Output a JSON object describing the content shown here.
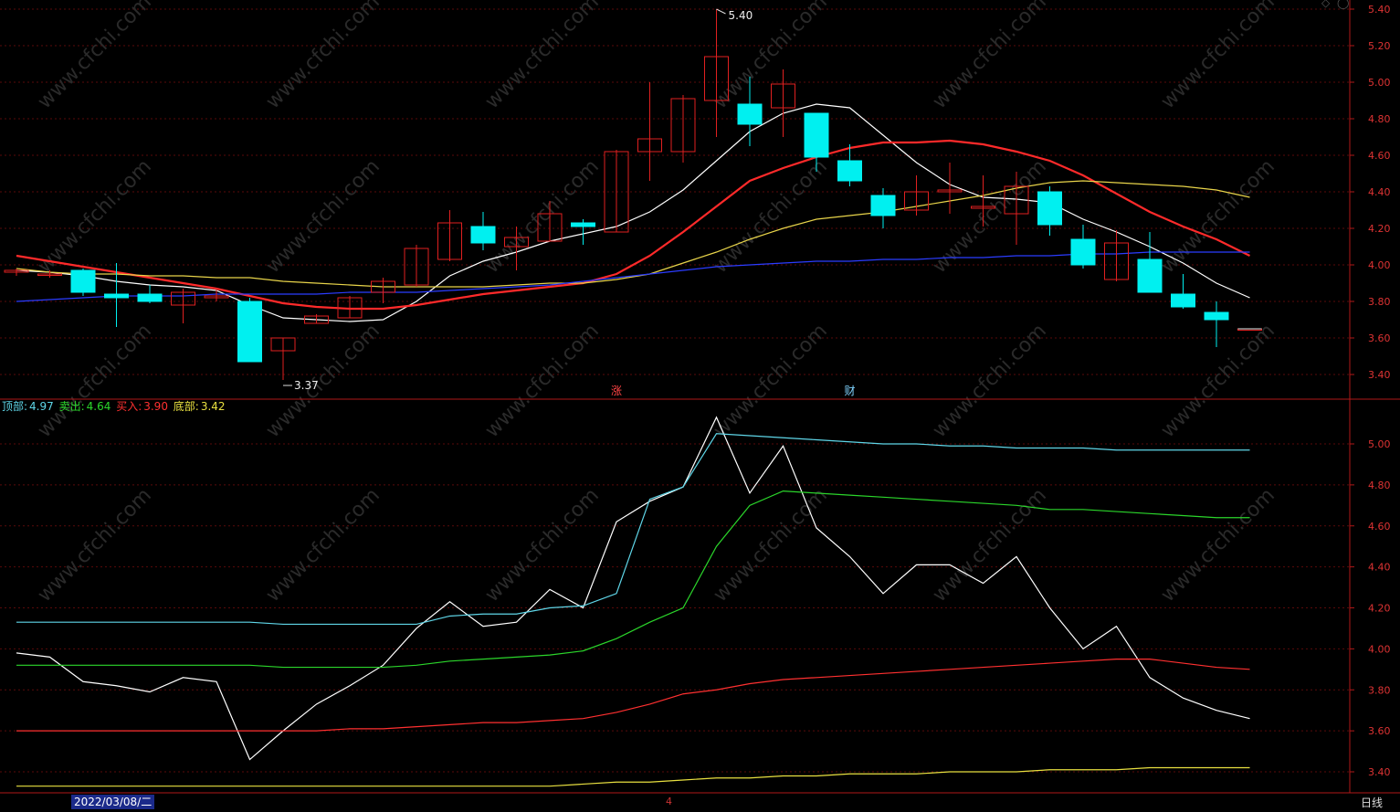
{
  "chart_data": [
    {
      "type": "candlestick",
      "y_axis_ticks": [
        "5.40",
        "5.20",
        "5.00",
        "4.80",
        "4.60",
        "4.40",
        "4.20",
        "4.00",
        "3.80",
        "3.60",
        "3.40"
      ],
      "ylim": [
        3.3,
        5.45
      ],
      "high_label": "5.40",
      "low_label": "3.37",
      "event_markers": [
        {
          "text": "涨",
          "index": 18,
          "color": "#ff4444"
        },
        {
          "text": "财",
          "index": 25,
          "color": "#7fd3ff"
        }
      ],
      "candles": [
        {
          "o": 3.96,
          "h": 3.98,
          "l": 3.94,
          "c": 3.97
        },
        {
          "o": 3.95,
          "h": 3.97,
          "l": 3.93,
          "c": 3.95
        },
        {
          "o": 3.97,
          "h": 3.98,
          "l": 3.83,
          "c": 3.85
        },
        {
          "o": 3.84,
          "h": 4.01,
          "l": 3.66,
          "c": 3.82
        },
        {
          "o": 3.84,
          "h": 3.89,
          "l": 3.79,
          "c": 3.8
        },
        {
          "o": 3.78,
          "h": 3.87,
          "l": 3.68,
          "c": 3.85
        },
        {
          "o": 3.82,
          "h": 3.87,
          "l": 3.8,
          "c": 3.83
        },
        {
          "o": 3.8,
          "h": 3.82,
          "l": 3.47,
          "c": 3.47
        },
        {
          "o": 3.53,
          "h": 3.6,
          "l": 3.37,
          "c": 3.6
        },
        {
          "o": 3.68,
          "h": 3.73,
          "l": 3.68,
          "c": 3.72
        },
        {
          "o": 3.71,
          "h": 3.83,
          "l": 3.71,
          "c": 3.82
        },
        {
          "o": 3.85,
          "h": 3.93,
          "l": 3.79,
          "c": 3.91
        },
        {
          "o": 3.89,
          "h": 4.11,
          "l": 3.88,
          "c": 4.09
        },
        {
          "o": 4.03,
          "h": 4.3,
          "l": 4.02,
          "c": 4.23
        },
        {
          "o": 4.21,
          "h": 4.29,
          "l": 4.08,
          "c": 4.12
        },
        {
          "o": 4.1,
          "h": 4.21,
          "l": 3.97,
          "c": 4.15
        },
        {
          "o": 4.13,
          "h": 4.35,
          "l": 4.13,
          "c": 4.28
        },
        {
          "o": 4.23,
          "h": 4.25,
          "l": 4.11,
          "c": 4.21
        },
        {
          "o": 4.18,
          "h": 4.63,
          "l": 4.18,
          "c": 4.62
        },
        {
          "o": 4.62,
          "h": 5.0,
          "l": 4.46,
          "c": 4.69
        },
        {
          "o": 4.62,
          "h": 4.93,
          "l": 4.56,
          "c": 4.91
        },
        {
          "o": 4.9,
          "h": 5.4,
          "l": 4.7,
          "c": 5.14
        },
        {
          "o": 4.88,
          "h": 5.03,
          "l": 4.65,
          "c": 4.77
        },
        {
          "o": 4.86,
          "h": 5.07,
          "l": 4.7,
          "c": 4.99
        },
        {
          "o": 4.83,
          "h": 4.83,
          "l": 4.51,
          "c": 4.59
        },
        {
          "o": 4.57,
          "h": 4.66,
          "l": 4.43,
          "c": 4.46
        },
        {
          "o": 4.38,
          "h": 4.42,
          "l": 4.2,
          "c": 4.27
        },
        {
          "o": 4.3,
          "h": 4.49,
          "l": 4.27,
          "c": 4.4
        },
        {
          "o": 4.4,
          "h": 4.56,
          "l": 4.28,
          "c": 4.41
        },
        {
          "o": 4.31,
          "h": 4.49,
          "l": 4.21,
          "c": 4.32
        },
        {
          "o": 4.28,
          "h": 4.51,
          "l": 4.11,
          "c": 4.43
        },
        {
          "o": 4.4,
          "h": 4.43,
          "l": 4.16,
          "c": 4.22
        },
        {
          "o": 4.14,
          "h": 4.22,
          "l": 3.98,
          "c": 4.0
        },
        {
          "o": 3.92,
          "h": 4.19,
          "l": 3.91,
          "c": 4.12
        },
        {
          "o": 4.03,
          "h": 4.18,
          "l": 3.85,
          "c": 3.85
        },
        {
          "o": 3.84,
          "h": 3.95,
          "l": 3.76,
          "c": 3.77
        },
        {
          "o": 3.74,
          "h": 3.8,
          "l": 3.55,
          "c": 3.7
        },
        {
          "o": 3.65,
          "h": 3.65,
          "l": 3.65,
          "c": 3.65
        }
      ],
      "series": [
        {
          "color": "#ffffff",
          "values": [
            3.97,
            3.96,
            3.94,
            3.91,
            3.89,
            3.88,
            3.86,
            3.78,
            3.71,
            3.7,
            3.69,
            3.7,
            3.8,
            3.94,
            4.02,
            4.07,
            4.13,
            4.17,
            4.21,
            4.29,
            4.41,
            4.57,
            4.73,
            4.83,
            4.88,
            4.86,
            4.71,
            4.56,
            4.44,
            4.37,
            4.36,
            4.34,
            4.25,
            4.18,
            4.1,
            4.01,
            3.9,
            3.82
          ]
        },
        {
          "color": "#ff2a2a",
          "values": [
            4.05,
            4.02,
            3.99,
            3.96,
            3.93,
            3.9,
            3.87,
            3.83,
            3.79,
            3.77,
            3.76,
            3.76,
            3.78,
            3.81,
            3.84,
            3.86,
            3.88,
            3.9,
            3.95,
            4.05,
            4.18,
            4.32,
            4.46,
            4.53,
            4.59,
            4.64,
            4.67,
            4.67,
            4.68,
            4.66,
            4.62,
            4.57,
            4.49,
            4.39,
            4.29,
            4.21,
            4.14,
            4.05
          ]
        },
        {
          "color": "#e8d44a",
          "values": [
            3.98,
            3.96,
            3.95,
            3.95,
            3.94,
            3.94,
            3.93,
            3.93,
            3.91,
            3.9,
            3.89,
            3.88,
            3.88,
            3.88,
            3.88,
            3.89,
            3.9,
            3.9,
            3.92,
            3.95,
            4.01,
            4.07,
            4.14,
            4.2,
            4.25,
            4.27,
            4.29,
            4.32,
            4.35,
            4.38,
            4.42,
            4.45,
            4.46,
            4.45,
            4.44,
            4.43,
            4.41,
            4.37
          ]
        },
        {
          "color": "#2b3cff",
          "values": [
            3.8,
            3.81,
            3.82,
            3.83,
            3.83,
            3.83,
            3.84,
            3.84,
            3.84,
            3.84,
            3.85,
            3.85,
            3.85,
            3.86,
            3.87,
            3.88,
            3.89,
            3.91,
            3.93,
            3.95,
            3.97,
            3.99,
            4.0,
            4.01,
            4.02,
            4.02,
            4.03,
            4.03,
            4.04,
            4.04,
            4.05,
            4.05,
            4.06,
            4.06,
            4.07,
            4.07,
            4.07,
            4.07
          ]
        }
      ]
    },
    {
      "type": "line",
      "y_axis_ticks": [
        "5.00",
        "4.80",
        "4.60",
        "4.40",
        "4.20",
        "4.00",
        "3.80",
        "3.60",
        "3.40"
      ],
      "ylim": [
        3.3,
        5.2
      ],
      "legend": [
        {
          "label": "顶部:",
          "value": "4.97",
          "color": "#5fd6e8"
        },
        {
          "label": "卖出:",
          "value": "4.64",
          "color": "#2bd62b"
        },
        {
          "label": "买入:",
          "value": "3.90",
          "color": "#ff3030"
        },
        {
          "label": "底部:",
          "value": "3.42",
          "color": "#e8e040"
        }
      ],
      "series": [
        {
          "color": "#ffffff",
          "values": [
            3.98,
            3.96,
            3.84,
            3.82,
            3.79,
            3.86,
            3.84,
            3.46,
            3.6,
            3.73,
            3.82,
            3.92,
            4.1,
            4.23,
            4.11,
            4.13,
            4.29,
            4.2,
            4.62,
            4.72,
            4.79,
            5.13,
            4.76,
            4.99,
            4.59,
            4.45,
            4.27,
            4.41,
            4.41,
            4.32,
            4.45,
            4.2,
            4.0,
            4.11,
            3.86,
            3.76,
            3.7,
            3.66
          ]
        },
        {
          "color": "#5fd6e8",
          "values": [
            4.13,
            4.13,
            4.13,
            4.13,
            4.13,
            4.13,
            4.13,
            4.13,
            4.12,
            4.12,
            4.12,
            4.12,
            4.12,
            4.16,
            4.17,
            4.17,
            4.2,
            4.21,
            4.27,
            4.73,
            4.79,
            5.05,
            5.04,
            5.03,
            5.02,
            5.01,
            5.0,
            5.0,
            4.99,
            4.99,
            4.98,
            4.98,
            4.98,
            4.97,
            4.97,
            4.97,
            4.97,
            4.97
          ]
        },
        {
          "color": "#2bd62b",
          "values": [
            3.92,
            3.92,
            3.92,
            3.92,
            3.92,
            3.92,
            3.92,
            3.92,
            3.91,
            3.91,
            3.91,
            3.91,
            3.92,
            3.94,
            3.95,
            3.96,
            3.97,
            3.99,
            4.05,
            4.13,
            4.2,
            4.5,
            4.7,
            4.77,
            4.76,
            4.75,
            4.74,
            4.73,
            4.72,
            4.71,
            4.7,
            4.68,
            4.68,
            4.67,
            4.66,
            4.65,
            4.64,
            4.64
          ]
        },
        {
          "color": "#ff3030",
          "values": [
            3.6,
            3.6,
            3.6,
            3.6,
            3.6,
            3.6,
            3.6,
            3.6,
            3.6,
            3.6,
            3.61,
            3.61,
            3.62,
            3.63,
            3.64,
            3.64,
            3.65,
            3.66,
            3.69,
            3.73,
            3.78,
            3.8,
            3.83,
            3.85,
            3.86,
            3.87,
            3.88,
            3.89,
            3.9,
            3.91,
            3.92,
            3.93,
            3.94,
            3.95,
            3.95,
            3.93,
            3.91,
            3.9
          ]
        },
        {
          "color": "#e8e040",
          "values": [
            3.33,
            3.33,
            3.33,
            3.33,
            3.33,
            3.33,
            3.33,
            3.33,
            3.33,
            3.33,
            3.33,
            3.33,
            3.33,
            3.33,
            3.33,
            3.33,
            3.33,
            3.34,
            3.35,
            3.35,
            3.36,
            3.37,
            3.37,
            3.38,
            3.38,
            3.39,
            3.39,
            3.39,
            3.4,
            3.4,
            3.4,
            3.41,
            3.41,
            3.41,
            3.42,
            3.42,
            3.42,
            3.42
          ]
        }
      ]
    }
  ],
  "footer": {
    "date": "2022/03/08/二",
    "month_tick": "4",
    "period": "日线"
  },
  "colors": {
    "up": "#e02020",
    "down": "#00f0f0",
    "grid": "#5a0a0a",
    "axis": "#b01818"
  }
}
